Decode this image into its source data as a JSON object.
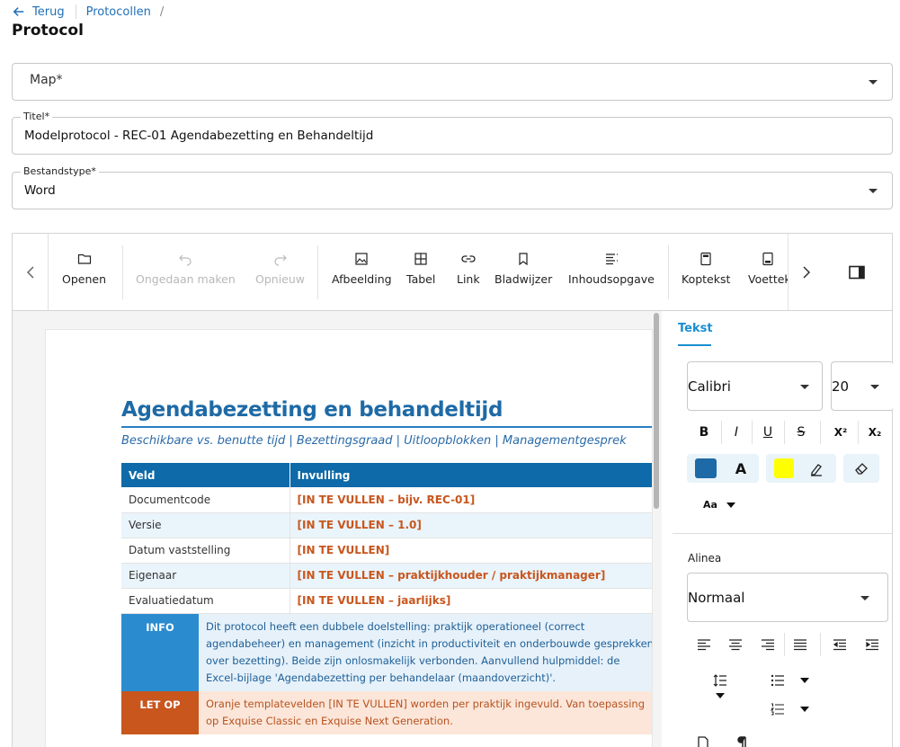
{
  "nav": {
    "back_label": "Terug",
    "breadcrumb": "Protocollen",
    "separator": "/"
  },
  "page_title": "Protocol",
  "form": {
    "map": {
      "placeholder": "Map*"
    },
    "titel": {
      "label": "Titel*",
      "value": "Modelprotocol - REC-01 Agendabezetting en Behandeltijd"
    },
    "bestandstype": {
      "label": "Bestandstype*",
      "value": "Word"
    }
  },
  "toolbar": {
    "items": [
      {
        "label": "Openen",
        "icon": "folder-icon",
        "enabled": true
      },
      {
        "label": "Ongedaan maken",
        "icon": "undo-icon",
        "enabled": false
      },
      {
        "label": "Opnieuw",
        "icon": "redo-icon",
        "enabled": false
      },
      {
        "label": "Afbeelding",
        "icon": "image-icon",
        "enabled": true
      },
      {
        "label": "Tabel",
        "icon": "table-icon",
        "enabled": true
      },
      {
        "label": "Link",
        "icon": "link-icon",
        "enabled": true
      },
      {
        "label": "Bladwijzer",
        "icon": "bookmark-icon",
        "enabled": true
      },
      {
        "label": "Inhoudsopgave",
        "icon": "toc-icon",
        "enabled": true
      },
      {
        "label": "Koptekst",
        "icon": "header-icon",
        "enabled": true
      },
      {
        "label": "Voettek",
        "icon": "footer-icon",
        "enabled": true
      }
    ]
  },
  "document": {
    "title": "Agendabezetting en behandeltijd",
    "subtitle": "Beschikbare vs. benutte tijd | Bezettingsgraad | Uitloopblokken | Managementgesprek",
    "table": {
      "headers": [
        "Veld",
        "Invulling"
      ],
      "rows": [
        [
          "Documentcode",
          "[IN TE VULLEN – bijv. REC-01]"
        ],
        [
          "Versie",
          "[IN TE VULLEN – 1.0]"
        ],
        [
          "Datum vaststelling",
          "[IN TE VULLEN]"
        ],
        [
          "Eigenaar",
          "[IN TE VULLEN – praktijkhouder / praktijkmanager]"
        ],
        [
          "Evaluatiedatum",
          "[IN TE VULLEN – jaarlijks]"
        ]
      ]
    },
    "info": {
      "tag": "INFO",
      "text": "Dit protocol heeft een dubbele doelstelling: praktijk operationeel (correct agendabeheer) en management (inzicht in productiviteit en onderbouwde gesprekken over bezetting). Beide zijn onlosmakelijk verbonden. Aanvullend hulpmiddel: de Excel-bijlage 'Agendabezetting per behandelaar (maandoverzicht)'."
    },
    "letop": {
      "tag": "LET OP",
      "text": "Oranje templatevelden [IN TE VULLEN] worden per praktijk ingevuld. Van toepassing op Exquise Classic en Exquise Next Generation."
    }
  },
  "sidebar": {
    "tab": "Tekst",
    "font": "Calibri",
    "size": "20",
    "format_buttons": [
      "B",
      "I",
      "U",
      "S",
      "X²",
      "X₂"
    ],
    "font_color": "#1e6aa6",
    "font_color_letter": "A",
    "highlight_color": "#ffff00",
    "case_label": "Aa",
    "paragraph_label": "Alinea",
    "paragraph_style": "Normaal"
  }
}
